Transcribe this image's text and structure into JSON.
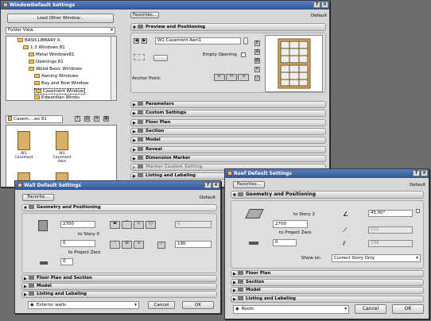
{
  "window_dialog": {
    "title": "WindowDefault Settings",
    "load_btn": "Load Other Window...",
    "view_select": "Folder View",
    "tree": [
      {
        "label": "BASICLIBRARY 0.",
        "indent": 2
      },
      {
        "label": "1.3 Windows 81",
        "indent": 3
      },
      {
        "label": "Metal Windows81",
        "indent": 4
      },
      {
        "label": "Openings 81",
        "indent": 4
      },
      {
        "label": "Wood Basic Windows",
        "indent": 4
      },
      {
        "label": "Awning Windows",
        "indent": 5
      },
      {
        "label": "Bay and Bow Window",
        "indent": 5
      },
      {
        "label": "Casement Window",
        "indent": 5
      },
      {
        "label": "Edwardian Windo",
        "indent": 5
      }
    ],
    "folder_select": "Casem....ws 81",
    "thumbs": [
      {
        "caption": "W1 Casement"
      },
      {
        "caption": "W1 Casement Awni"
      }
    ],
    "favorites": "Favorites...",
    "default_label": "Default",
    "section_preview": "Preview and Positioning",
    "name_field": "W1 Casement Awn1",
    "empty_opening": "Empty Opening",
    "anchor_label": "Anchor Point:",
    "sections": [
      "Parameters",
      "Custom Settings",
      "Floor Plan",
      "Section",
      "Model",
      "Reveal",
      "Dimension Marker",
      "Marker Custom Setting",
      "Listing and Labeling"
    ]
  },
  "wall_dialog": {
    "title": "Wall Default Settings",
    "favorites": "Favorite...",
    "default_label": "Default",
    "section_geometry": "Geometry and Positioning",
    "height": "2700",
    "to_story": "to Story 0",
    "base_offset": "0",
    "to_project_zero": "to Project Zero",
    "offset_val": "0",
    "thickness": "190",
    "disabled_val": "0",
    "sections": [
      "Floor Plan and Section",
      "Model",
      "Listing and Labeling"
    ],
    "bottom_select": "Exterior walls",
    "cancel": "Cancel",
    "ok": "OK"
  },
  "roof_dialog": {
    "title": "Roof Default Settings",
    "favorites": "Favorites...",
    "default_label": "Default",
    "section_geometry": "Geometry and Positioning",
    "to_story": "to Story 2",
    "height": "2700",
    "to_project_zero": "to Project Zero",
    "base": "0",
    "angle": "45.00°",
    "disabled1": "111",
    "disabled2": "199",
    "show_on_label": "Show on:",
    "show_on_value": "Current Story Only",
    "sections": [
      "Floor Plan",
      "Section",
      "Model",
      "Listing and Labeling"
    ],
    "bottom_select": "Roofs",
    "cancel": "Cancel",
    "ok": "OK"
  }
}
